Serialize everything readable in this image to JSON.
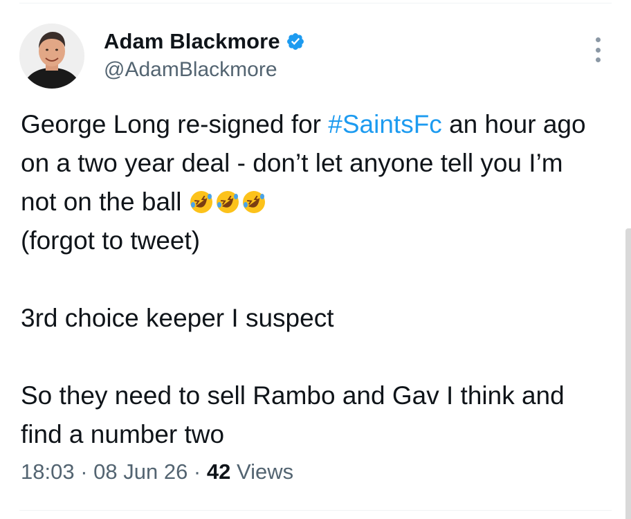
{
  "author": {
    "display_name": "Adam Blackmore",
    "handle": "@AdamBlackmore",
    "verified_icon": "verified-badge-icon",
    "avatar": "profile-photo"
  },
  "tweet": {
    "text_before_hashtag": "George Long re-signed for ",
    "hashtag": "#SaintsFc",
    "text_after_hashtag": " an hour ago on a two year deal - don’t let anyone tell you I’m not on the ball ",
    "emojis": [
      "rolling-on-floor-laughing-emoji",
      "rolling-on-floor-laughing-emoji",
      "rolling-on-floor-laughing-emoji"
    ],
    "line_after_emojis": "(forgot to tweet)",
    "paragraph_2": "3rd choice keeper I suspect",
    "paragraph_3": "So they need to sell Rambo and Gav I think and find a number two"
  },
  "meta": {
    "time": "18:03",
    "separator": " · ",
    "date": "08 Jun 26",
    "views_count": "42",
    "views_label": " Views"
  },
  "colors": {
    "link": "#1d9bf0",
    "text": "#0f1419",
    "secondary": "#536471",
    "verified": "#1d9bf0"
  }
}
